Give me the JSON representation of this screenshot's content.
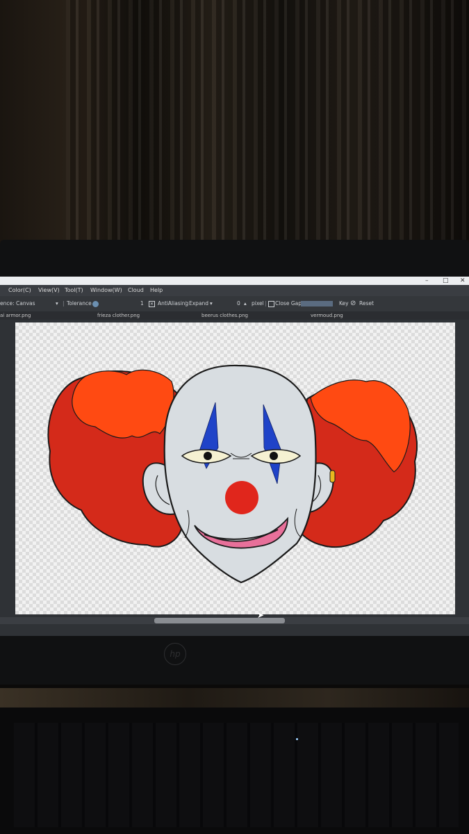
{
  "window": {
    "controls": [
      "–",
      "□",
      "✕"
    ]
  },
  "menu": {
    "items": [
      "Color(C)",
      "View(V)",
      "Tool(T)",
      "Window(W)",
      "Cloud",
      "Help"
    ]
  },
  "toolbar": {
    "reference_label": "ence: Canvas",
    "reference_dropdown": "▾",
    "tolerance_label": "Tolerance",
    "tolerance_value": "1",
    "antialiasing_label": "AntiAliasing",
    "antialiasing_check": "✕",
    "expand_label": "Expand",
    "expand_dropdown": "▾",
    "expand_value": "0",
    "expand_stepper": "▴",
    "expand_unit": "pixel",
    "close_gaps_label": "Close Gaps",
    "key_label": "Key",
    "reset_label": "Reset",
    "reset_icon": "⃠"
  },
  "tabs": [
    "ai armor.png",
    "frieza clother.png",
    "beerus clothes.png",
    "vermoud.png"
  ],
  "canvas": {
    "subject": "clown-face",
    "colors": {
      "hair_light": "#ff4a12",
      "hair_dark": "#d42a1a",
      "skin": "#d8dde1",
      "nose": "#e0261c",
      "eye_paint": "#1f43c8",
      "mouth": "#e8709a",
      "outline": "#1a1a1a",
      "earring": "#e9b81f"
    }
  },
  "scrollbar": {
    "horizontal_position": 0.35
  }
}
